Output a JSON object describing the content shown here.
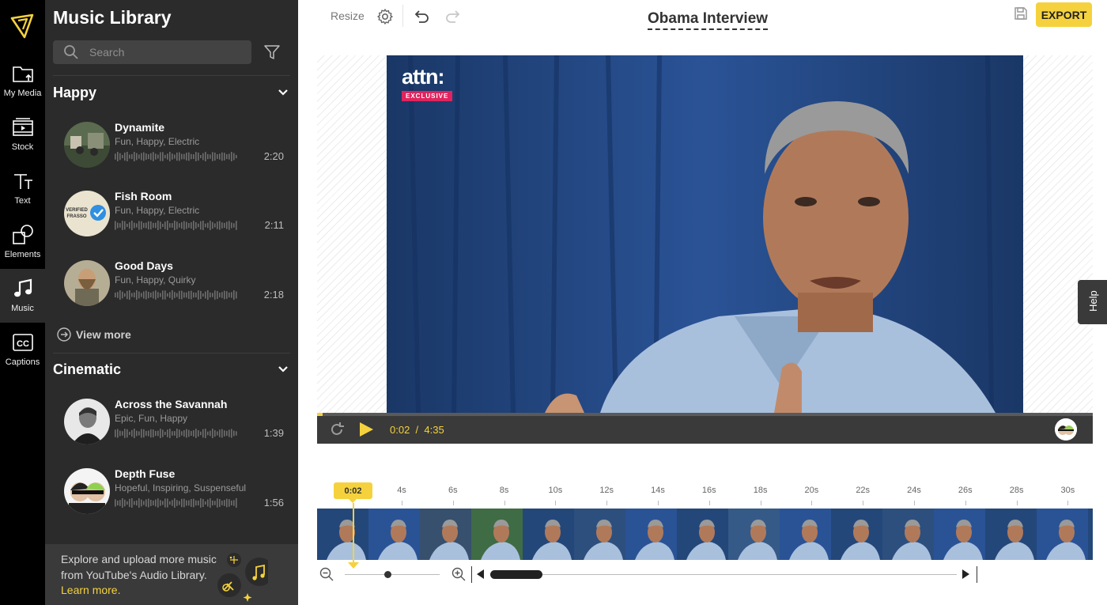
{
  "rail": {
    "items": [
      {
        "label": "My Media",
        "icon": "folder-upload-icon"
      },
      {
        "label": "Stock",
        "icon": "film-icon"
      },
      {
        "label": "Text",
        "icon": "text-icon"
      },
      {
        "label": "Elements",
        "icon": "shapes-icon"
      },
      {
        "label": "Music",
        "icon": "music-note-icon"
      },
      {
        "label": "Captions",
        "icon": "cc-icon"
      }
    ],
    "active": "Music"
  },
  "panel": {
    "title": "Music Library",
    "search_placeholder": "Search",
    "categories": [
      {
        "name": "Happy",
        "tracks": [
          {
            "name": "Dynamite",
            "tags": "Fun, Happy, Electric",
            "duration": "2:20"
          },
          {
            "name": "Fish Room",
            "tags": "Fun, Happy, Electric",
            "duration": "2:11"
          },
          {
            "name": "Good Days",
            "tags": "Fun, Happy, Quirky",
            "duration": "2:18"
          }
        ],
        "view_more": "View more"
      },
      {
        "name": "Cinematic",
        "tracks": [
          {
            "name": "Across the Savannah",
            "tags": "Epic, Fun, Happy",
            "duration": "1:39"
          },
          {
            "name": "Depth Fuse",
            "tags": "Hopeful, Inspiring, Suspenseful",
            "duration": "1:56"
          }
        ]
      }
    ],
    "promo": {
      "text": "Explore and upload more music from YouTube's Audio Library.",
      "link": "Learn more."
    }
  },
  "editor": {
    "resize_label": "Resize",
    "project_title": "Obama Interview",
    "export_label": "EXPORT",
    "help_label": "Help",
    "video_badge": {
      "brand": "attn:",
      "tag": "EXCLUSIVE"
    },
    "player": {
      "current": "0:02",
      "separator": "/",
      "total": "4:35",
      "progress_fraction": 0.007
    },
    "timeline": {
      "marker": "0:02",
      "ticks": [
        "4s",
        "6s",
        "8s",
        "10s",
        "12s",
        "14s",
        "16s",
        "18s",
        "20s",
        "22s",
        "24s",
        "26s",
        "28s",
        "30s"
      ]
    }
  },
  "colors": {
    "accent": "#f5d23d",
    "rail": "#000000",
    "panel": "#2b2b2b",
    "video_bg": "#24477a"
  }
}
